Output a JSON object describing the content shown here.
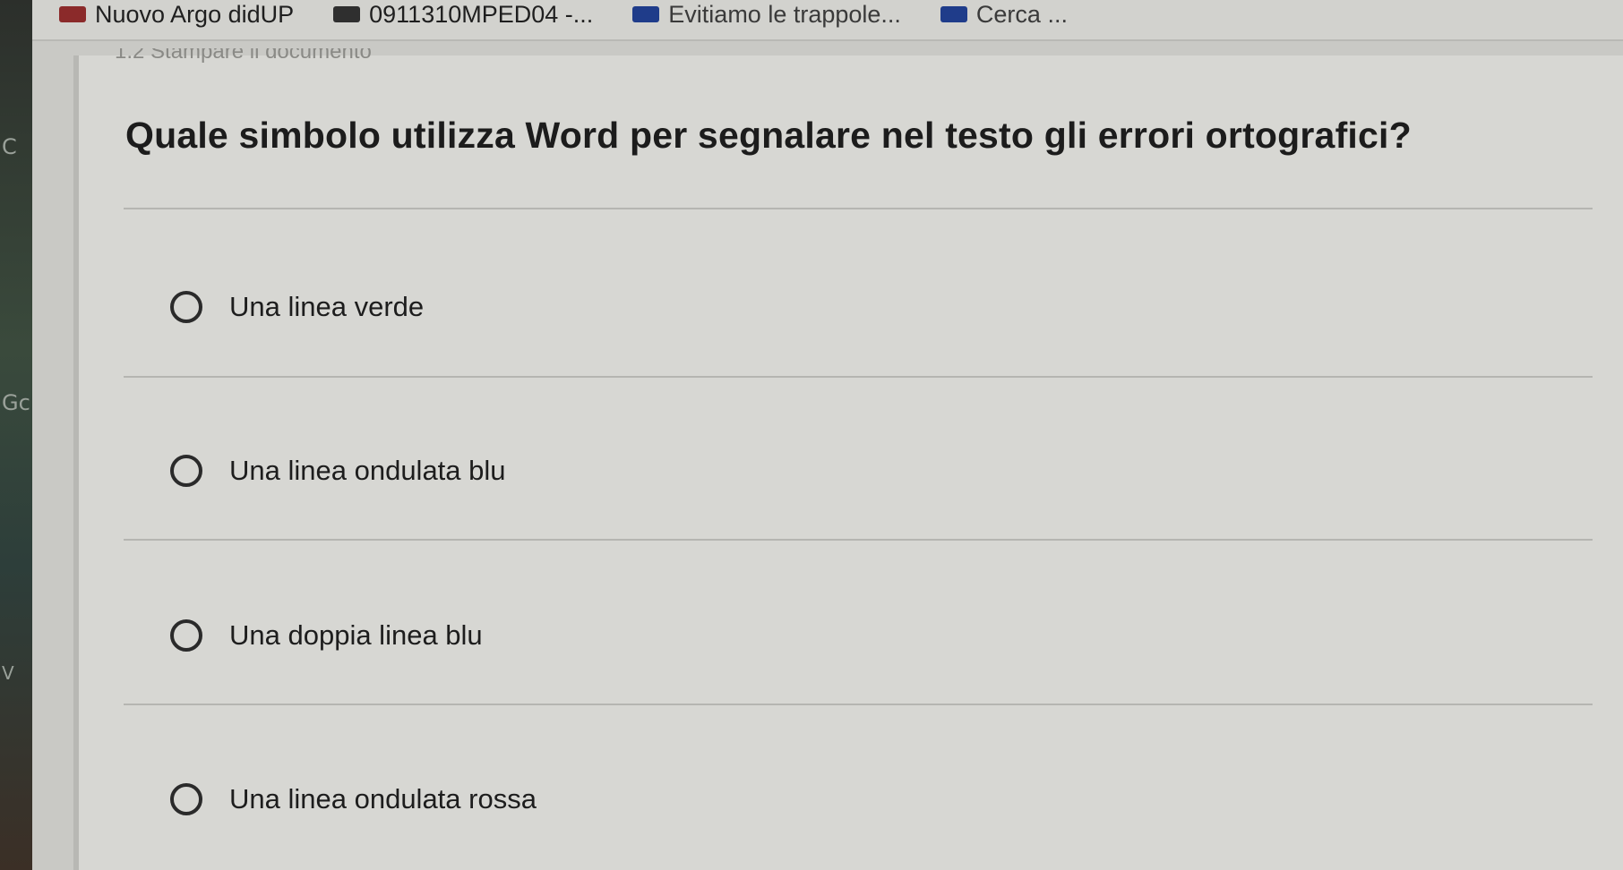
{
  "bookmarks": [
    {
      "label": "Nuovo Argo didUP",
      "color": "#8b2a2a"
    },
    {
      "label": "0911310MPED04 -...",
      "color": "#2f2f2f"
    },
    {
      "label": "Evitiamo le trappole...",
      "color": "#1f3c8a"
    },
    {
      "label": "Cerca ...",
      "color": "#1f3c8a"
    }
  ],
  "form": {
    "section_heading": "1.2 Stampare il documento",
    "question": "Quale simbolo utilizza Word per segnalare nel testo gli errori ortografici?",
    "options": [
      {
        "label": "Una linea verde",
        "selected": false
      },
      {
        "label": "Una linea ondulata blu",
        "selected": false
      },
      {
        "label": "Una doppia linea blu",
        "selected": false
      },
      {
        "label": "Una linea ondulata rossa",
        "selected": false
      }
    ]
  },
  "background_fragments": {
    "a": "C",
    "b": "Gc",
    "c": "V"
  }
}
